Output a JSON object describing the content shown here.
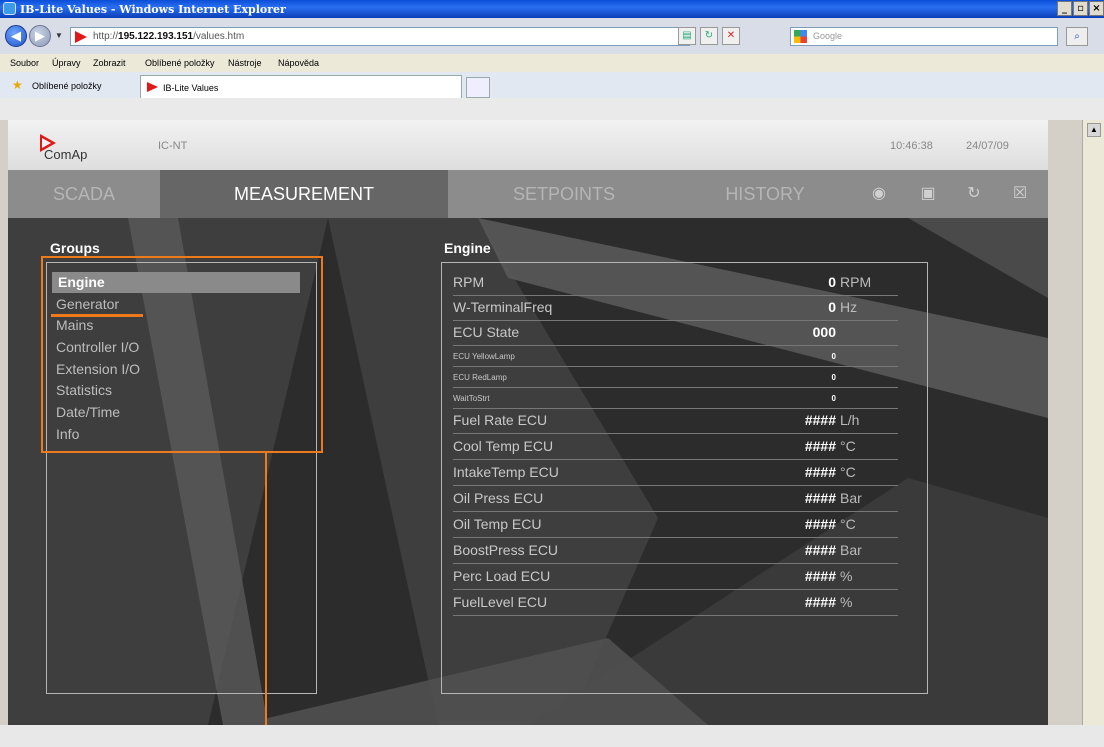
{
  "browser": {
    "title": "IB-Lite Values - Windows Internet Explorer",
    "url_prefix": "http://",
    "url_host": "195.122.193.151",
    "url_path": "/values.htm",
    "search_placeholder": "Google",
    "menu": [
      "Soubor",
      "Úpravy",
      "Zobrazit",
      "Oblíbené položky",
      "Nástroje",
      "Nápověda"
    ],
    "favorites_label": "Oblíbené položky",
    "tab_title": "IB-Lite Values"
  },
  "header": {
    "logo": "ComAp",
    "controller": "IC-NT",
    "time": "10:46:38",
    "date": "24/07/09"
  },
  "nav": {
    "tabs": [
      "SCADA",
      "MEASUREMENT",
      "SETPOINTS",
      "HISTORY"
    ],
    "active": "MEASUREMENT"
  },
  "groups": {
    "title": "Groups",
    "items": [
      "Engine",
      "Generator",
      "Mains",
      "Controller I/O",
      "Extension I/O",
      "Statistics",
      "Date/Time",
      "Info"
    ],
    "active": "Engine"
  },
  "engine": {
    "title": "Engine",
    "rows": [
      {
        "name": "RPM",
        "value": "0",
        "unit": "RPM"
      },
      {
        "name": "W-TerminalFreq",
        "value": "0",
        "unit": "Hz"
      },
      {
        "name": "ECU State",
        "value": "000",
        "unit": ""
      },
      {
        "name": "ECU YellowLamp",
        "value": "0",
        "unit": ""
      },
      {
        "name": "ECU RedLamp",
        "value": "0",
        "unit": ""
      },
      {
        "name": "WaitToStrt",
        "value": "0",
        "unit": ""
      },
      {
        "name": "Fuel Rate ECU",
        "value": "####",
        "unit": "L/h"
      },
      {
        "name": "Cool Temp ECU",
        "value": "####",
        "unit": "°C"
      },
      {
        "name": "IntakeTemp ECU",
        "value": "####",
        "unit": "°C"
      },
      {
        "name": "Oil Press ECU",
        "value": "####",
        "unit": "Bar"
      },
      {
        "name": "Oil Temp ECU",
        "value": "####",
        "unit": "°C"
      },
      {
        "name": "BoostPress ECU",
        "value": "####",
        "unit": "Bar"
      },
      {
        "name": "Perc Load ECU",
        "value": "####",
        "unit": "%"
      },
      {
        "name": "FuelLevel ECU",
        "value": "####",
        "unit": "%"
      }
    ]
  },
  "colors": {
    "accent_orange": "#ef7a1a",
    "brand_red": "#e01818",
    "active_tab": "#666666"
  }
}
